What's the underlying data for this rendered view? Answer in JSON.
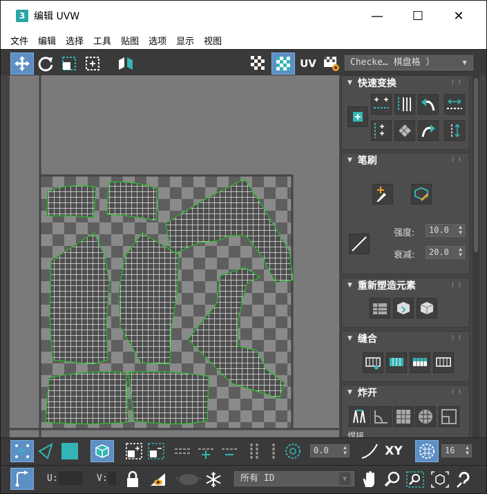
{
  "window": {
    "app_icon": "3",
    "title": "编辑 UVW",
    "minimize": "—",
    "maximize": "☐",
    "close": "✕"
  },
  "menu": [
    "文件",
    "编辑",
    "选择",
    "工具",
    "贴图",
    "选项",
    "显示",
    "视图"
  ],
  "toolbar": {
    "tools": [
      "move-icon",
      "rotate-icon",
      "scale-icon",
      "freeform-icon",
      "mirror-icon"
    ],
    "uv_label": "UV",
    "checker_value": "Checke… 棋盘格 ）",
    "checker_arrow": "▼"
  },
  "panels": {
    "quick_transform": {
      "title": "快速变换"
    },
    "brush": {
      "title": "笔刷",
      "strength_label": "强度:",
      "strength_value": "10.0",
      "falloff_label": "衰减:",
      "falloff_value": "20.0"
    },
    "reshape": {
      "title": "重新塑造元素"
    },
    "stitch": {
      "title": "缝合"
    },
    "explode": {
      "title": "炸开",
      "weld_label": "焊接"
    }
  },
  "bottom": {
    "offset_value": "0.0",
    "xy_label": "XY",
    "grid_value": "16",
    "u_label": "U:",
    "v_label": "V:",
    "filter_value": "所有 ID"
  },
  "colors": {
    "accent": "#5d8fc4",
    "teal": "#34b5b5",
    "seam": "#26c026",
    "checker_light": "#8a8a8a",
    "checker_dark": "#5e5e5e"
  }
}
